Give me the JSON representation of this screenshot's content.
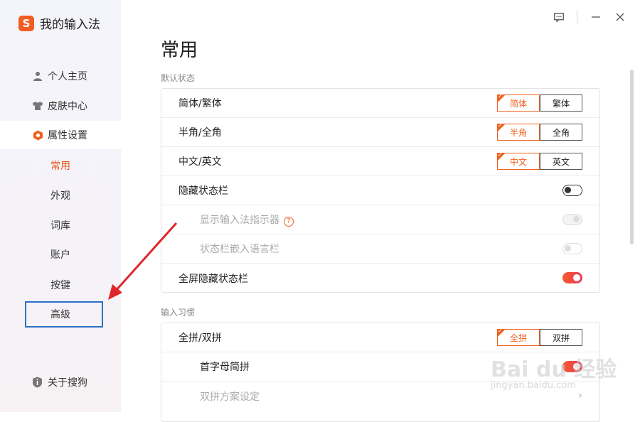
{
  "app": {
    "title": "我的输入法",
    "logo_letter": "S"
  },
  "sidebar": {
    "items": [
      {
        "label": "个人主页",
        "icon": "person-icon"
      },
      {
        "label": "皮肤中心",
        "icon": "shirt-icon"
      },
      {
        "label": "属性设置",
        "icon": "hexagon-settings-icon",
        "active": true
      }
    ],
    "subitems": [
      {
        "label": "常用",
        "active": true
      },
      {
        "label": "外观"
      },
      {
        "label": "词库"
      },
      {
        "label": "账户"
      },
      {
        "label": "按键"
      },
      {
        "label": "高级"
      }
    ],
    "about": "关于搜狗"
  },
  "main": {
    "title": "常用",
    "sections": [
      {
        "label": "默认状态",
        "rows": [
          {
            "label": "简体/繁体",
            "type": "segmented",
            "options": [
              "简体",
              "繁体"
            ],
            "selected": 0
          },
          {
            "label": "半角/全角",
            "type": "segmented",
            "options": [
              "半角",
              "全角"
            ],
            "selected": 0
          },
          {
            "label": "中文/英文",
            "type": "segmented",
            "options": [
              "中文",
              "英文"
            ],
            "selected": 0
          },
          {
            "label": "隐藏状态栏",
            "type": "toggle",
            "state": "off"
          },
          {
            "label": "显示输入法指示器",
            "type": "toggle",
            "state": "disabled",
            "help": "?"
          },
          {
            "label": "状态栏嵌入语言栏",
            "type": "toggle",
            "state": "disabled"
          },
          {
            "label": "全屏隐藏状态栏",
            "type": "toggle",
            "state": "on"
          }
        ]
      },
      {
        "label": "输入习惯",
        "rows": [
          {
            "label": "全拼/双拼",
            "type": "segmented",
            "options": [
              "全拼",
              "双拼"
            ],
            "selected": 0
          },
          {
            "label": "首字母简拼",
            "type": "toggle",
            "state": "on"
          },
          {
            "label": "双拼方案设定",
            "type": "link"
          }
        ]
      }
    ]
  },
  "colors": {
    "accent": "#f0601e",
    "highlight_box": "#2d6fc6",
    "arrow": "#e0262b"
  },
  "watermark": {
    "main": "Bai du 经验",
    "sub": "jingyan.baidu.com"
  }
}
